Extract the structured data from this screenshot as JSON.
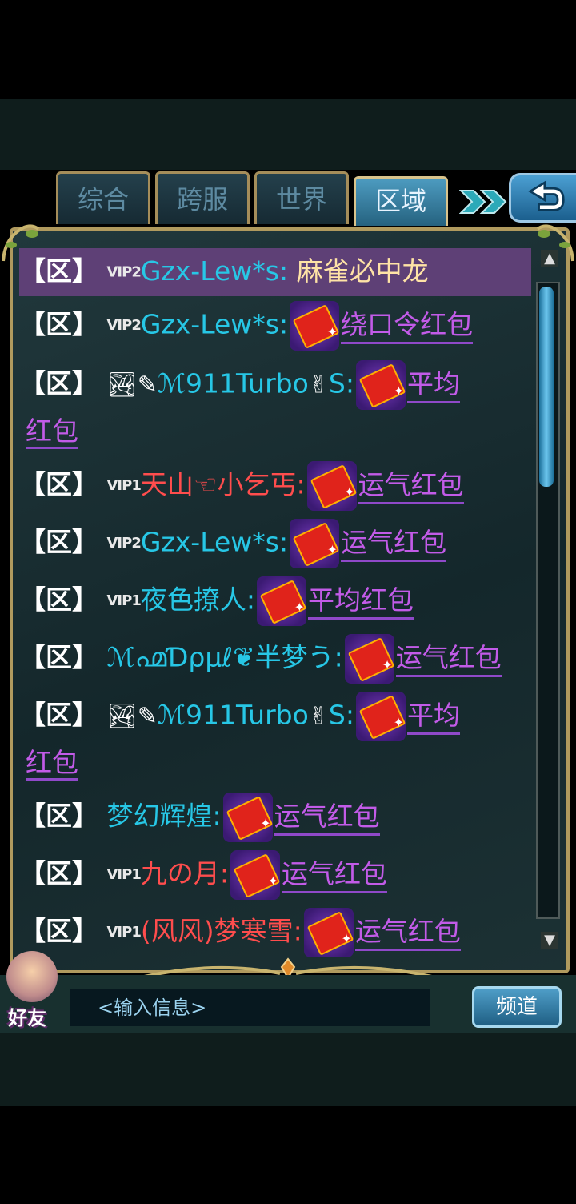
{
  "tabs": [
    {
      "label": "综合"
    },
    {
      "label": "跨服"
    },
    {
      "label": "世界"
    },
    {
      "label": "区域"
    }
  ],
  "messages": [
    {
      "tag": "【区】",
      "vip": "VIP2",
      "name": "Gzx-Lew*s:",
      "text": "麻雀必中龙"
    },
    {
      "tag": "【区】",
      "vip": "VIP2",
      "name": "Gzx-Lew*s:",
      "packet": "绕口令红包"
    },
    {
      "tag": "【区】",
      "icons": "🏞✎",
      "name": "ℳ911Turbo",
      "emoji": "✌",
      "suffix": "S:",
      "packet": "平均",
      "packet_wrap": "红包"
    },
    {
      "tag": "【区】",
      "vip": "VIP1",
      "name": "天山☜小乞丐:",
      "packet": "运气红包"
    },
    {
      "tag": "【区】",
      "vip": "VIP2",
      "name": "Gzx-Lew*s:",
      "packet": "运气红包"
    },
    {
      "tag": "【区】",
      "vip": "VIP1",
      "name": "夜色撩人:",
      "packet": "平均红包"
    },
    {
      "tag": "【区】",
      "name": "ℳ൶Ɗρμℓ❦半梦う:",
      "packet": "运气红包"
    },
    {
      "tag": "【区】",
      "icons": "🏞✎",
      "name": "ℳ911Turbo",
      "emoji": "✌",
      "suffix": "S:",
      "packet": "平均",
      "packet_wrap": "红包"
    },
    {
      "tag": "【区】",
      "name": "梦幻辉煌:",
      "packet": "运气红包"
    },
    {
      "tag": "【区】",
      "vip": "VIP1",
      "name": "九の月:",
      "packet": "运气红包"
    },
    {
      "tag": "【区】",
      "vip": "VIP1",
      "name": "(风风)梦寒雪:",
      "packet": "运气红包"
    }
  ],
  "bottom": {
    "friend_label": "好友",
    "input_placeholder": "<输入信息>",
    "channel_label": "频道"
  },
  "colors": {
    "highlight_row": "#5e4076",
    "name_cyan": "#27c7e6",
    "name_red": "#ff4d4d",
    "packet_purple": "#c25be8",
    "active_tab": "#4d9bc0"
  }
}
